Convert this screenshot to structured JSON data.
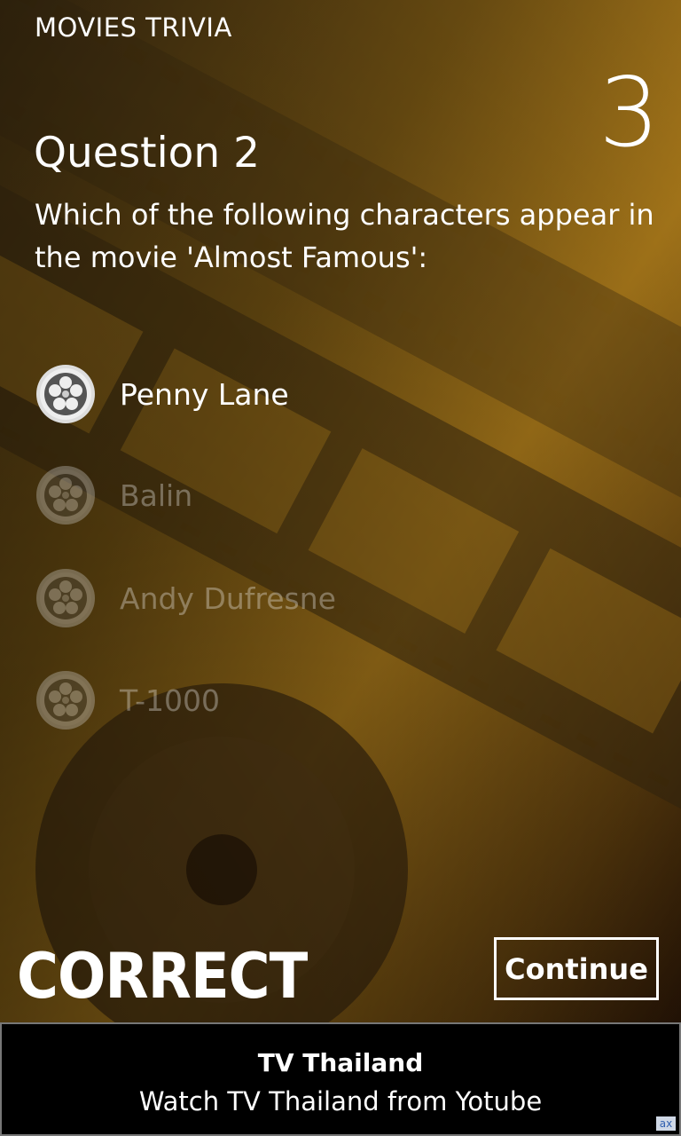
{
  "app": {
    "title": "MOVIES TRIVIA"
  },
  "score": "3",
  "question": {
    "title": "Question 2",
    "text": "Which of the following characters appear in the movie 'Almost Famous':"
  },
  "options": [
    {
      "label": "Penny Lane",
      "state": "correct"
    },
    {
      "label": "Balin",
      "state": "disabled"
    },
    {
      "label": "Andy Dufresne",
      "state": "disabled"
    },
    {
      "label": "T-1000",
      "state": "disabled"
    }
  ],
  "result": {
    "text": "CORRECT"
  },
  "continue_button": {
    "label": "Continue"
  },
  "ad": {
    "title": "TV Thailand",
    "subtitle": "Watch TV Thailand from Yotube",
    "badge": "ax"
  },
  "colors": {
    "background_dark": "#2a1a08",
    "background_gold": "#c8901a",
    "ad_background": "#000000"
  }
}
